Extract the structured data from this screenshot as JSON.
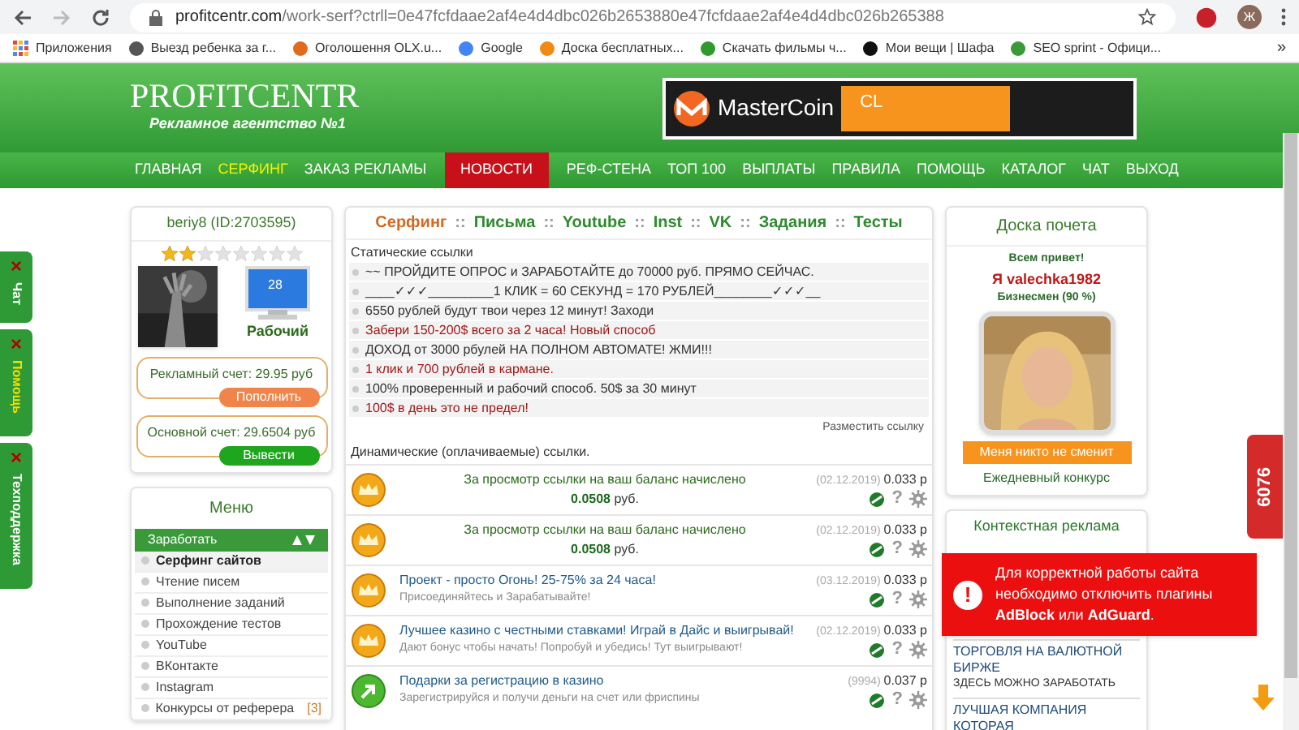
{
  "browser": {
    "url_host": "profitcentr.com",
    "url_path": "/work-serf?ctrll=0e47fcfdaae2af4e4d4dbc026b2653880e47fcfdaae2af4e4d4dbc026b265388",
    "profile_initial": "Ж",
    "apps": "Приложения",
    "more": "»",
    "bookmarks": [
      {
        "label": "Выезд ребенка за г..."
      },
      {
        "label": "Оголошення OLX.u..."
      },
      {
        "label": "Google"
      },
      {
        "label": "Доска бесплатных..."
      },
      {
        "label": "Скачать фильмы ч..."
      },
      {
        "label": "Мои вещи | Шафа"
      },
      {
        "label": "SEO sprint - Офици..."
      }
    ]
  },
  "header": {
    "logo": "PROFITCENTR",
    "slogan": "Рекламное агентство №1",
    "banner": "MasterCoin",
    "banner_text": "CL"
  },
  "nav": [
    {
      "label": "ГЛАВНАЯ",
      "kind": "normal",
      "selected": false
    },
    {
      "label": "СЕРФИНГ",
      "kind": "normal",
      "selected": true
    },
    {
      "label": "ЗАКАЗ РЕКЛАМЫ",
      "kind": "normal",
      "selected": false
    },
    {
      "label": "НОВОСТИ",
      "kind": "news",
      "selected": false
    },
    {
      "label": "РЕФ-СТЕНА",
      "kind": "normal",
      "selected": false
    },
    {
      "label": "ТОП 100",
      "kind": "normal",
      "selected": false
    },
    {
      "label": "ВЫПЛАТЫ",
      "kind": "normal",
      "selected": false
    },
    {
      "label": "ПРАВИЛА",
      "kind": "normal",
      "selected": false
    },
    {
      "label": "ПОМОЩЬ",
      "kind": "normal",
      "selected": false
    },
    {
      "label": "КАТАЛОГ",
      "kind": "normal",
      "selected": false
    },
    {
      "label": "ЧАТ",
      "kind": "normal",
      "selected": false
    },
    {
      "label": "ВЫХОД",
      "kind": "normal",
      "selected": false
    }
  ],
  "side_tabs": [
    {
      "label": "Чат",
      "close": "×",
      "kind": "normal"
    },
    {
      "label": "Помощь",
      "close": "×",
      "kind": "accent"
    },
    {
      "label": "Техподдержка",
      "close": "×",
      "kind": "normal"
    }
  ],
  "profile": {
    "username": "beriy8 (ID:2703595)",
    "stars": 2,
    "monitor": "28",
    "status": "Рабочий",
    "ad_account": "Рекламный счет: 29.95 руб",
    "topup": "Пополнить",
    "main_account": "Основной счет: 29.6504 руб",
    "withdraw": "Вывести"
  },
  "menu": {
    "title": "Меню",
    "section": "Заработать",
    "items": [
      {
        "label": "Серфинг сайтов",
        "selected": true
      },
      {
        "label": "Чтение писем",
        "selected": false
      },
      {
        "label": "Выполнение заданий",
        "selected": false
      },
      {
        "label": "Прохождение тестов",
        "selected": false
      },
      {
        "label": "YouTube",
        "selected": false
      },
      {
        "label": "ВКонтакте",
        "selected": false
      },
      {
        "label": "Instagram",
        "selected": false
      },
      {
        "label": "Конкурсы от реферера",
        "selected": false,
        "count": "[3]"
      }
    ]
  },
  "work_tabs": {
    "separator": "::",
    "items": [
      {
        "label": "Серфинг",
        "selected": true
      },
      {
        "label": "Письма",
        "selected": false
      },
      {
        "label": "Youtube",
        "selected": false
      },
      {
        "label": "Inst",
        "selected": false
      },
      {
        "label": "VK",
        "selected": false
      },
      {
        "label": "Задания",
        "selected": false
      },
      {
        "label": "Тесты",
        "selected": false
      }
    ]
  },
  "static_links": {
    "title": "Статические ссылки",
    "place_link": "Разместить ссылку",
    "items": [
      {
        "text": "~~ ПРОЙДИТЕ ОПРОС и ЗАРАБОТАЙТЕ до 70000 руб. ПРЯМО СЕЙЧАС.",
        "color": "#333333"
      },
      {
        "text": "____✓✓✓_________1 КЛИК = 60 СЕКУНД = 170 РУБЛЕЙ________✓✓✓__",
        "color": "#333333"
      },
      {
        "text": "6550 рублей будут твои через 12 минут! Заходи",
        "color": "#333333"
      },
      {
        "text": "Забери 150-200$ всего за 2 часа! Новый способ",
        "color": "#a01818"
      },
      {
        "text": "ДОХОД от 3000 рбулей НА ПОЛНОМ АВТОМАТЕ! ЖМИ!!!",
        "color": "#333333"
      },
      {
        "text": "1 клик и 700 рублей в кармане.",
        "color": "#a01818"
      },
      {
        "text": "100% проверенный и рабочий способ. 50$ за 30 минут",
        "color": "#333333"
      },
      {
        "text": "100$ в день это не предел!",
        "color": "#a01818"
      }
    ]
  },
  "dynamic_links": {
    "title": "Динамические (оплачиваемые) ссылки.",
    "items": [
      {
        "kind": "paid",
        "title": "За просмотр ссылки на ваш баланс начислено",
        "amount": "0.0508",
        "currency": "руб.",
        "date": "(02.12.2019)",
        "price": "0.033 р",
        "help": "?"
      },
      {
        "kind": "paid",
        "title": "За просмотр ссылки на ваш баланс начислено",
        "amount": "0.0508",
        "currency": "руб.",
        "date": "(02.12.2019)",
        "price": "0.033 р",
        "help": "?"
      },
      {
        "kind": "link",
        "title": "Проект - просто Огонь! 25-75% за 24 часа!",
        "subtitle": "Присоединяйтесь и Зарабатывайте!",
        "date": "(03.12.2019)",
        "price": "0.033 р",
        "help": "?"
      },
      {
        "kind": "link",
        "title": "Лучшее казино с честными ставками! Играй в Дайс и выигрывай!",
        "subtitle": "Дают бонус чтобы начать! Попробуй и убедись! Тут выигрывают!",
        "date": "(02.12.2019)",
        "price": "0.033 р",
        "help": "?"
      },
      {
        "kind": "gift",
        "title": "Подарки за регистрацию в казино",
        "subtitle": "Зарегистрируйся и получи деньги на счет или фриспины",
        "date": "(9994)",
        "price": "0.037 р",
        "help": "?"
      }
    ]
  },
  "honor": {
    "title": "Доска почета",
    "greeting": "Всем привет!",
    "name": "Я valechka1982",
    "rank": "Бизнесмен (90 %)",
    "button": "Меня никто не сменит",
    "contest": "Ежедневный конкурс"
  },
  "context_ads": {
    "title": "Контекстная реклама",
    "items": [
      {
        "title": "ТОРГОВЛЯ НА ВАЛЮТНОЙ БИРЖЕ",
        "subtitle": "ЗДЕСЬ МОЖНО ЗАРАБОТАТЬ"
      },
      {
        "title": "ЛУЧШАЯ КОМПАНИЯ КОТОРАЯ"
      }
    ]
  },
  "alert": {
    "icon": "!",
    "text": "Для корректной работы сайта необходимо отключить плагины **AdBlock** или **AdGuard**."
  },
  "counter": "6076"
}
